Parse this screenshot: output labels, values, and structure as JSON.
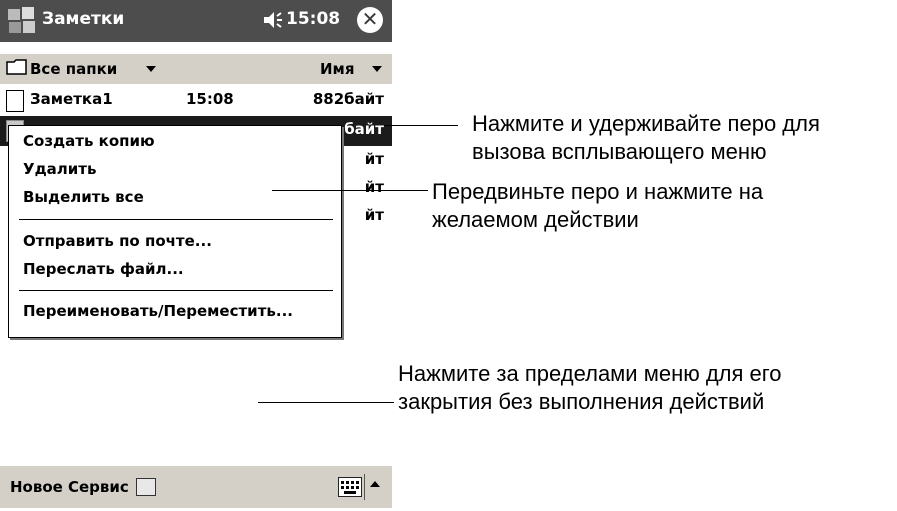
{
  "titlebar": {
    "app_title": "Заметки",
    "time": "15:08",
    "close_glyph": "✕",
    "icons": [
      "windows-start-icon",
      "speaker-icon",
      "close-icon"
    ]
  },
  "folderbar": {
    "folder_label": "Все папки",
    "sort_label": "Имя"
  },
  "list": {
    "rows": [
      {
        "name": "Заметка1",
        "time": "15:08",
        "size": "882байт"
      },
      {
        "name": "",
        "time": "",
        "size": "байт"
      },
      {
        "name": "",
        "time": "",
        "size": "йт"
      },
      {
        "name": "",
        "time": "",
        "size": "йт"
      },
      {
        "name": "",
        "time": "",
        "size": "йт"
      }
    ]
  },
  "menu": {
    "items": [
      "Создать копию",
      "Удалить",
      "Выделить все",
      "Отправить по почте...",
      "Переслать файл...",
      "Переименовать/Переместить..."
    ]
  },
  "bottombar": {
    "new_label": "Новое",
    "tools_label": "Сервис"
  },
  "callouts": {
    "hold": "Нажмите и удерживайте перо для вызова всплывающего меню",
    "move": "Передвиньте перо и нажмите на желаемом действии",
    "outside": "Нажмите за пределами меню для его закрытия без выполнения действий"
  }
}
